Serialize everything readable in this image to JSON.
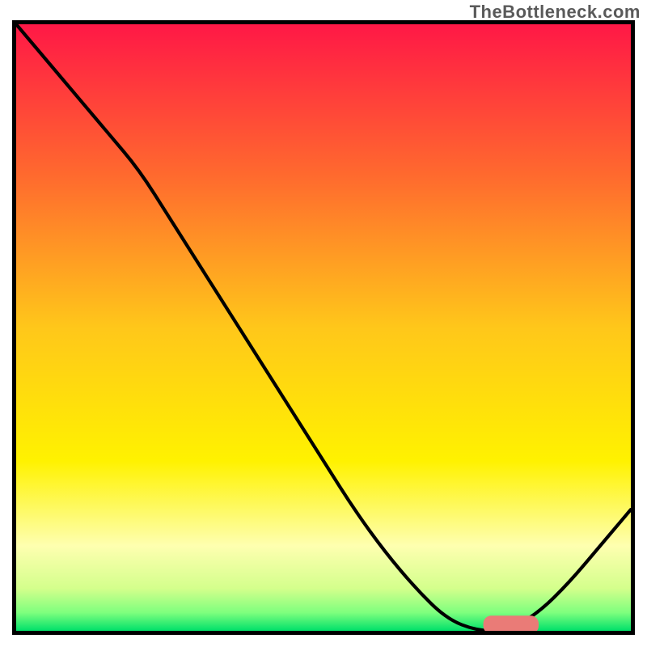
{
  "watermark": "TheBottleneck.com",
  "chart_data": {
    "type": "line",
    "title": "",
    "xlabel": "",
    "ylabel": "",
    "xlim": [
      0,
      100
    ],
    "ylim": [
      0,
      100
    ],
    "x": [
      0,
      5,
      10,
      15,
      20,
      25,
      30,
      35,
      40,
      45,
      50,
      55,
      60,
      65,
      70,
      75,
      80,
      85,
      90,
      95,
      100
    ],
    "values": [
      100,
      94,
      88,
      82,
      76,
      68,
      60,
      52,
      44,
      36,
      28,
      20,
      13,
      7,
      2,
      0,
      0,
      3,
      8,
      14,
      20
    ],
    "marker": {
      "x": 76,
      "y": 1,
      "width": 9,
      "height": 3
    },
    "gradient_stops": [
      {
        "offset": 0.0,
        "color": "#ff1846"
      },
      {
        "offset": 0.25,
        "color": "#ff6a2e"
      },
      {
        "offset": 0.5,
        "color": "#ffc71a"
      },
      {
        "offset": 0.72,
        "color": "#fff200"
      },
      {
        "offset": 0.86,
        "color": "#feffb0"
      },
      {
        "offset": 0.93,
        "color": "#d4ff8c"
      },
      {
        "offset": 0.97,
        "color": "#7eff7e"
      },
      {
        "offset": 1.0,
        "color": "#00e06a"
      }
    ]
  }
}
